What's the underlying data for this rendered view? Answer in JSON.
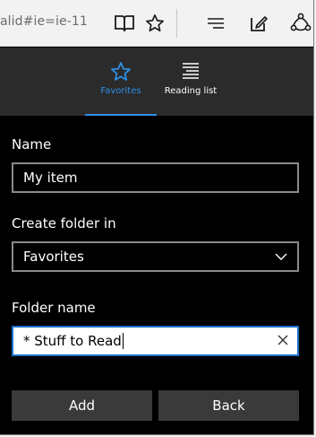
{
  "toolbar": {
    "url_fragment": "alid#ie=ie-11",
    "icons": [
      "reading-view-icon",
      "favorite-star-icon",
      "hub-icon",
      "web-note-icon",
      "share-icon"
    ]
  },
  "hub": {
    "tabs": [
      {
        "label": "Favorites",
        "icon": "star-icon",
        "active": true
      },
      {
        "label": "Reading list",
        "icon": "reading-list-icon",
        "active": false
      }
    ],
    "accent_color": "#2e8fe6"
  },
  "form": {
    "name_label": "Name",
    "name_value": "My item",
    "folder_label": "Create folder in",
    "folder_value": "Favorites",
    "folder_name_label": "Folder name",
    "folder_name_value": "* Stuff to Read"
  },
  "buttons": {
    "add_label": "Add",
    "back_label": "Back"
  }
}
